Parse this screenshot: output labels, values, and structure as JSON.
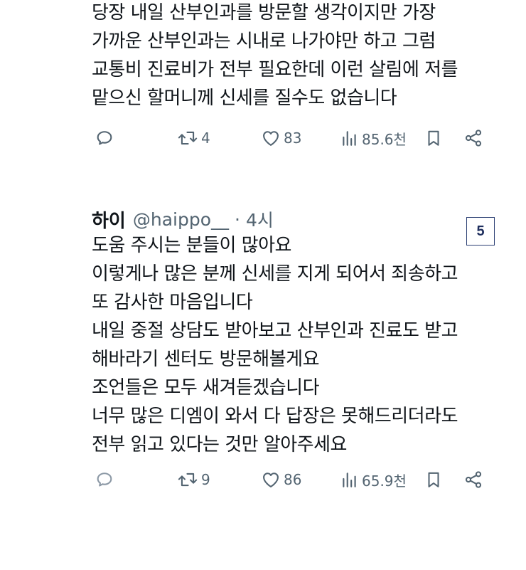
{
  "posts": [
    {
      "text_lines": [
        "당장 내일 산부인과를 방문할 생각이지만 가장",
        "가까운 산부인과는 시내로 나가야만 하고 그럼",
        "교통비 진료비가 전부 필요한데 이런 살림에 저를",
        "맡으신 할머니께 신세를 질수도 없습니다"
      ],
      "stats": {
        "retweets": "4",
        "likes": "83",
        "views": "85.6천"
      }
    },
    {
      "author": {
        "name": "하이",
        "handle": "@haippo__",
        "time": "4시"
      },
      "separator": "·",
      "text_lines": [
        "도움 주시는 분들이 많아요",
        "이렇게나 많은 분께 신세를 지게 되어서 죄송하고",
        "또 감사한 마음입니다",
        "내일 중절 상담도 받아보고 산부인과 진료도 받고",
        "해바라기 센터도 방문해볼게요",
        "조언들은 모두 새겨듣겠습니다",
        "너무 많은 디엠이 와서 다 답장은 못해드리더라도",
        "전부 읽고 있다는 것만 알아주세요"
      ],
      "stats": {
        "retweets": "9",
        "likes": "86",
        "views": "65.9천"
      }
    }
  ],
  "page_badge": "5",
  "icons": [
    "reply-icon",
    "retweet-icon",
    "like-icon",
    "views-icon",
    "bookmark-icon",
    "share-icon"
  ],
  "colors": {
    "text": "#0f1419",
    "secondary": "#536471",
    "badge_border": "#2b3f73"
  }
}
